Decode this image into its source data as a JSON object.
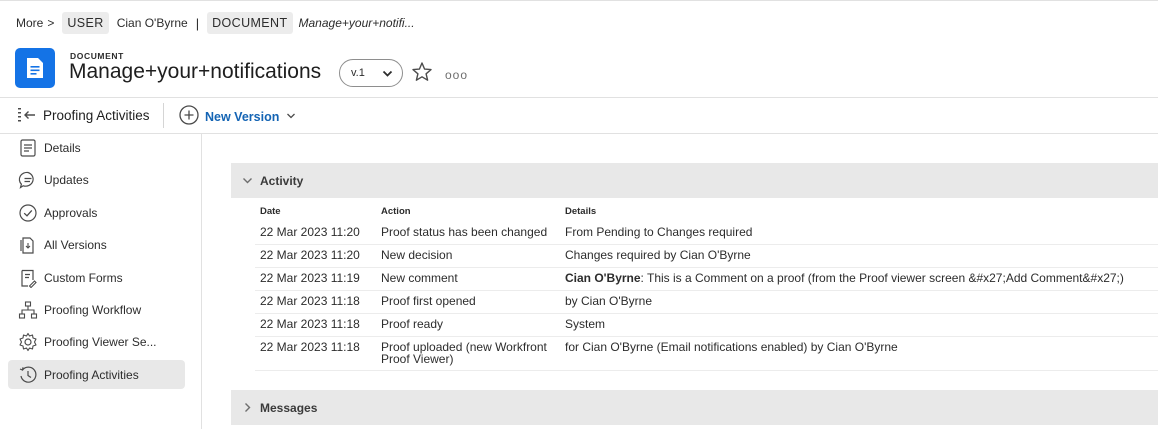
{
  "breadcrumb": {
    "more": "More",
    "sep": ">",
    "user_chip": "USER",
    "user_name": "Cian O'Byrne",
    "bar": "|",
    "doc_chip": "DOCUMENT",
    "current": "Manage+your+notifi..."
  },
  "header": {
    "object_type": "DOCUMENT",
    "title": "Manage+your+notifications",
    "version": "v.1",
    "more": "ooo",
    "icon_color": "#1473e6"
  },
  "toolbar": {
    "title": "Proofing Activities",
    "new_version": "New Version"
  },
  "sidebar": {
    "items": [
      {
        "label": "Details",
        "icon": "details-icon"
      },
      {
        "label": "Updates",
        "icon": "updates-icon"
      },
      {
        "label": "Approvals",
        "icon": "approvals-icon"
      },
      {
        "label": "All Versions",
        "icon": "all-versions-icon"
      },
      {
        "label": "Custom Forms",
        "icon": "custom-forms-icon"
      },
      {
        "label": "Proofing Workflow",
        "icon": "proofing-workflow-icon"
      },
      {
        "label": "Proofing Viewer Se...",
        "icon": "gear-icon"
      },
      {
        "label": "Proofing Activities",
        "icon": "proofing-activities-icon",
        "active": true
      }
    ]
  },
  "activity": {
    "title": "Activity",
    "columns": {
      "date": "Date",
      "action": "Action",
      "details": "Details"
    },
    "rows": [
      {
        "date": "22 Mar 2023 11:20",
        "action": "Proof status has been changed",
        "details": "From Pending to Changes required"
      },
      {
        "date": "22 Mar 2023 11:20",
        "action": "New decision",
        "details": "Changes required by Cian O'Byrne"
      },
      {
        "date": "22 Mar 2023 11:19",
        "action": "New comment",
        "author": "Cian O'Byrne",
        "details": ": This is a Comment on a proof (from the Proof viewer screen &#x27;Add Comment&#x27;)"
      },
      {
        "date": "22 Mar 2023 11:18",
        "action": "Proof first opened",
        "details": "by Cian O'Byrne"
      },
      {
        "date": "22 Mar 2023 11:18",
        "action": "Proof ready",
        "details": "System"
      },
      {
        "date": "22 Mar 2023 11:18",
        "action": "Proof uploaded (new Workfront Proof Viewer)",
        "details": "for Cian O'Byrne (Email notifications enabled) by Cian O'Byrne"
      }
    ]
  },
  "messages": {
    "title": "Messages"
  }
}
